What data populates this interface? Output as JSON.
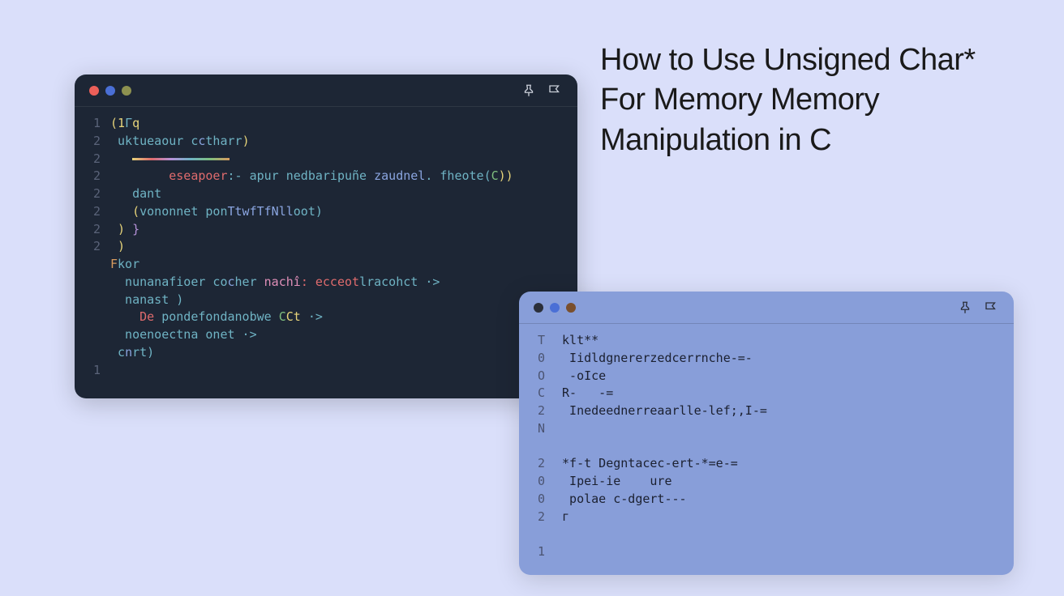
{
  "title": "How to Use Unsigned Char* For Memory Memory Manipulation in C",
  "win1": {
    "lines": [
      {
        "no": "1"
      },
      {
        "no": "2"
      },
      {
        "no": "2"
      },
      {
        "no": "2"
      },
      {
        "no": "2"
      },
      {
        "no": "2"
      },
      {
        "no": "2"
      },
      {
        "no": "2"
      },
      {
        "no": ""
      },
      {
        "no": ""
      },
      {
        "no": ""
      },
      {
        "no": ""
      },
      {
        "no": ""
      },
      {
        "no": ""
      },
      {
        "no": "1"
      }
    ],
    "code": {
      "l1_a": "(1",
      "l1_b": "Г",
      "l1_c": "q",
      "l2_a": " uktueaour c",
      "l2_b": "c",
      "l2_c": "tharr",
      "l2_d": ")",
      "l3_pad": "   ",
      "l4_pad": "        ",
      "l4_a": "eseapoer",
      "l4_b": ":- apur nedbaripuñe ",
      "l4_c": "zaudnel",
      "l4_d": ". fheote(",
      "l4_e": "C",
      "l4_f": "))",
      "l5_a": "   dant",
      "l6_a": "   (",
      "l6_b": "vononnet",
      "l6_c": " pon",
      "l6_d": "TtwfTfNll",
      "l6_e": "oot)",
      "l7_a": " ) ",
      "l7_b": "}",
      "l8_a": " )",
      "l9_a": "F",
      "l9_b": "kor",
      "l10_a": "  nunanafioer co",
      "l10_b": "c",
      "l10_c": "her ",
      "l10_d": "nachî",
      "l10_e": ": ecceot",
      "l10_f": "lracohct",
      "l10_g": " ·>",
      "l11_a": "  nanast )",
      "l12_a": "    ",
      "l12_b": "De",
      "l12_c": " pondefondanobwe ",
      "l12_d": "C",
      "l12_e": "Ct",
      "l12_f": " ·>",
      "l13_a": "  noenoectna onet ·>",
      "l14_a": " c",
      "l14_b": "n",
      "l14_c": "rt)"
    }
  },
  "win2": {
    "lines": [
      {
        "no": "T"
      },
      {
        "no": "0"
      },
      {
        "no": "O"
      },
      {
        "no": "C"
      },
      {
        "no": "2"
      },
      {
        "no": "N"
      },
      {
        "no": ""
      },
      {
        "no": "2"
      },
      {
        "no": "0"
      },
      {
        "no": "0"
      },
      {
        "no": "2"
      },
      {
        "no": ""
      },
      {
        "no": "1"
      }
    ],
    "code": {
      "l1": " klt**",
      "l2": "  Iidldgnererzedcerrnche-=-",
      "l3": "  -оIсе",
      "l4": " R-   -=",
      "l5": "  Іnedeednerreаarlle-lef;,I-=",
      "l6": "",
      "l7": "",
      "l8": " *f-t Degntacec-ert-*=e-=",
      "l9": "  Ipei-ie    ure",
      "l10": "  polаe c-dgert---",
      "l11": " г"
    }
  }
}
